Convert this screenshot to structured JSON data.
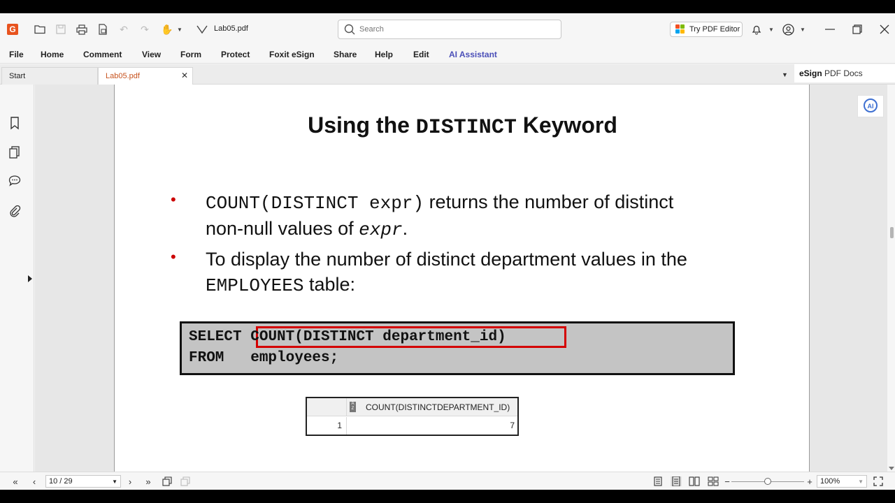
{
  "window": {
    "doc_title": "Lab05.pdf",
    "search_placeholder": "Search",
    "try_pdf_editor": "Try PDF Editor"
  },
  "menu": [
    "File",
    "Home",
    "Comment",
    "View",
    "Form",
    "Protect",
    "Foxit eSign",
    "Share",
    "Help",
    "Edit",
    "AI Assistant"
  ],
  "tabs": {
    "start": "Start",
    "active": "Lab05.pdf"
  },
  "esign": {
    "bold": "eSign",
    "rest": " PDF Docs"
  },
  "slide": {
    "title_pre": "Using the ",
    "title_code": "DISTINCT",
    "title_post": " Keyword",
    "bullet1_code": "COUNT(DISTINCT expr)",
    "bullet1_text": " returns the number of distinct",
    "bullet1_line2": "non-null values of ",
    "bullet1_expr": "expr",
    "bullet1_end": ".",
    "bullet2_line1": "To display the number of distinct department values in the",
    "bullet2_code": "EMPLOYEES",
    "bullet2_text": " table:",
    "code_line1_kw": "SELECT",
    "code_line1_expr": "COUNT(DISTINCT department_id)",
    "code_line2": "FROM   employees;",
    "result": {
      "column": "COUNT(DISTINCTDEPARTMENT_ID)",
      "row_number": "1",
      "value": "7"
    }
  },
  "status": {
    "page_indicator": "10 / 29",
    "zoom": "100%"
  }
}
